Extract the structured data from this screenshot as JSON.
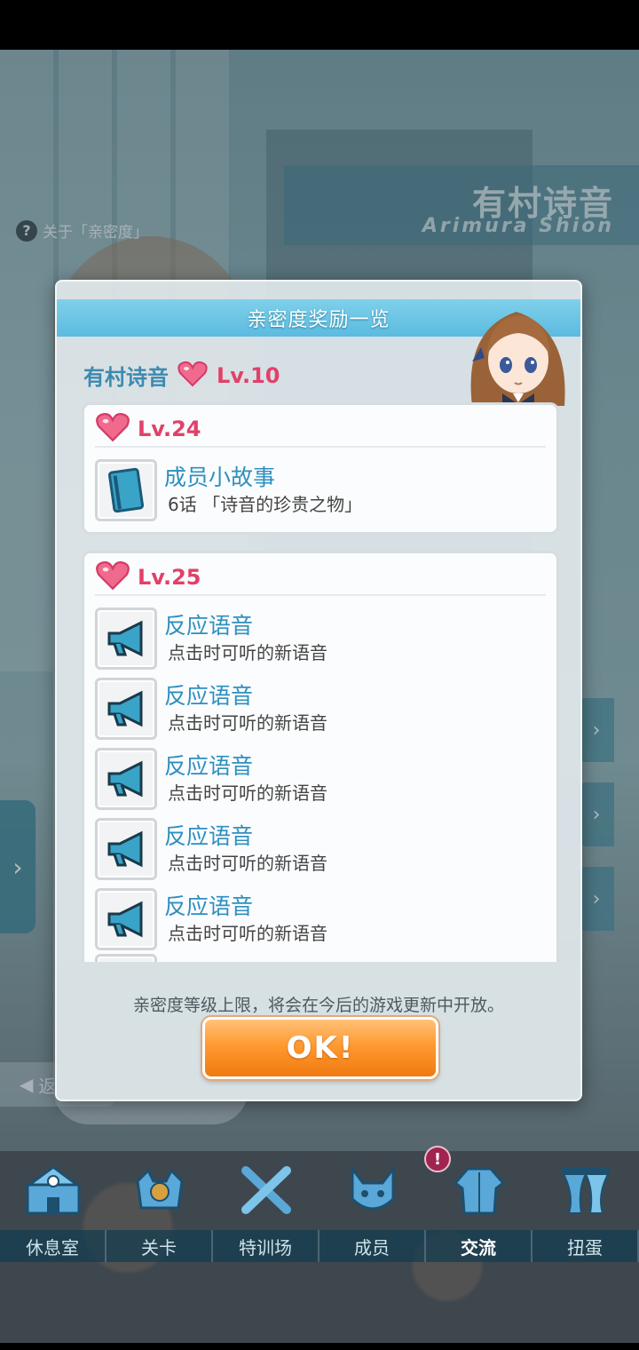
{
  "background": {
    "about_link": "关于「亲密度」",
    "about_q": "?",
    "name_jp": "有村诗音",
    "name_roman": "Arimura Shion",
    "back_label": "返回"
  },
  "modal": {
    "title": "亲密度奖励一览",
    "character_name": "有村诗音",
    "character_level": "Lv.10",
    "levels": [
      {
        "level": "Lv.24",
        "rewards": [
          {
            "title": "成员小故事",
            "desc": "6话 「诗音的珍贵之物」",
            "icon": "book-icon"
          }
        ]
      },
      {
        "level": "Lv.25",
        "rewards": [
          {
            "title": "反应语音",
            "desc": "点击时可听的新语音",
            "icon": "megaphone-icon"
          },
          {
            "title": "反应语音",
            "desc": "点击时可听的新语音",
            "icon": "megaphone-icon"
          },
          {
            "title": "反应语音",
            "desc": "点击时可听的新语音",
            "icon": "megaphone-icon"
          },
          {
            "title": "反应语音",
            "desc": "点击时可听的新语音",
            "icon": "megaphone-icon"
          },
          {
            "title": "反应语音",
            "desc": "点击时可听的新语音",
            "icon": "megaphone-icon"
          }
        ]
      }
    ],
    "notice": "亲密度等级上限，将会在今后的游戏更新中开放。",
    "ok_label": "OK!"
  },
  "bottom_nav": {
    "items": [
      {
        "label": "休息室",
        "icon": "lounge-icon"
      },
      {
        "label": "关卡",
        "icon": "stage-icon"
      },
      {
        "label": "特训场",
        "icon": "training-icon"
      },
      {
        "label": "成员",
        "icon": "members-icon"
      },
      {
        "label": "交流",
        "icon": "communication-icon"
      },
      {
        "label": "扭蛋",
        "icon": "gacha-icon"
      }
    ],
    "active_index": 4,
    "badge": "!"
  },
  "colors": {
    "accent_blue": "#2e8fc0",
    "level_pink": "#e2406a",
    "ok_orange": "#ff9a30"
  }
}
